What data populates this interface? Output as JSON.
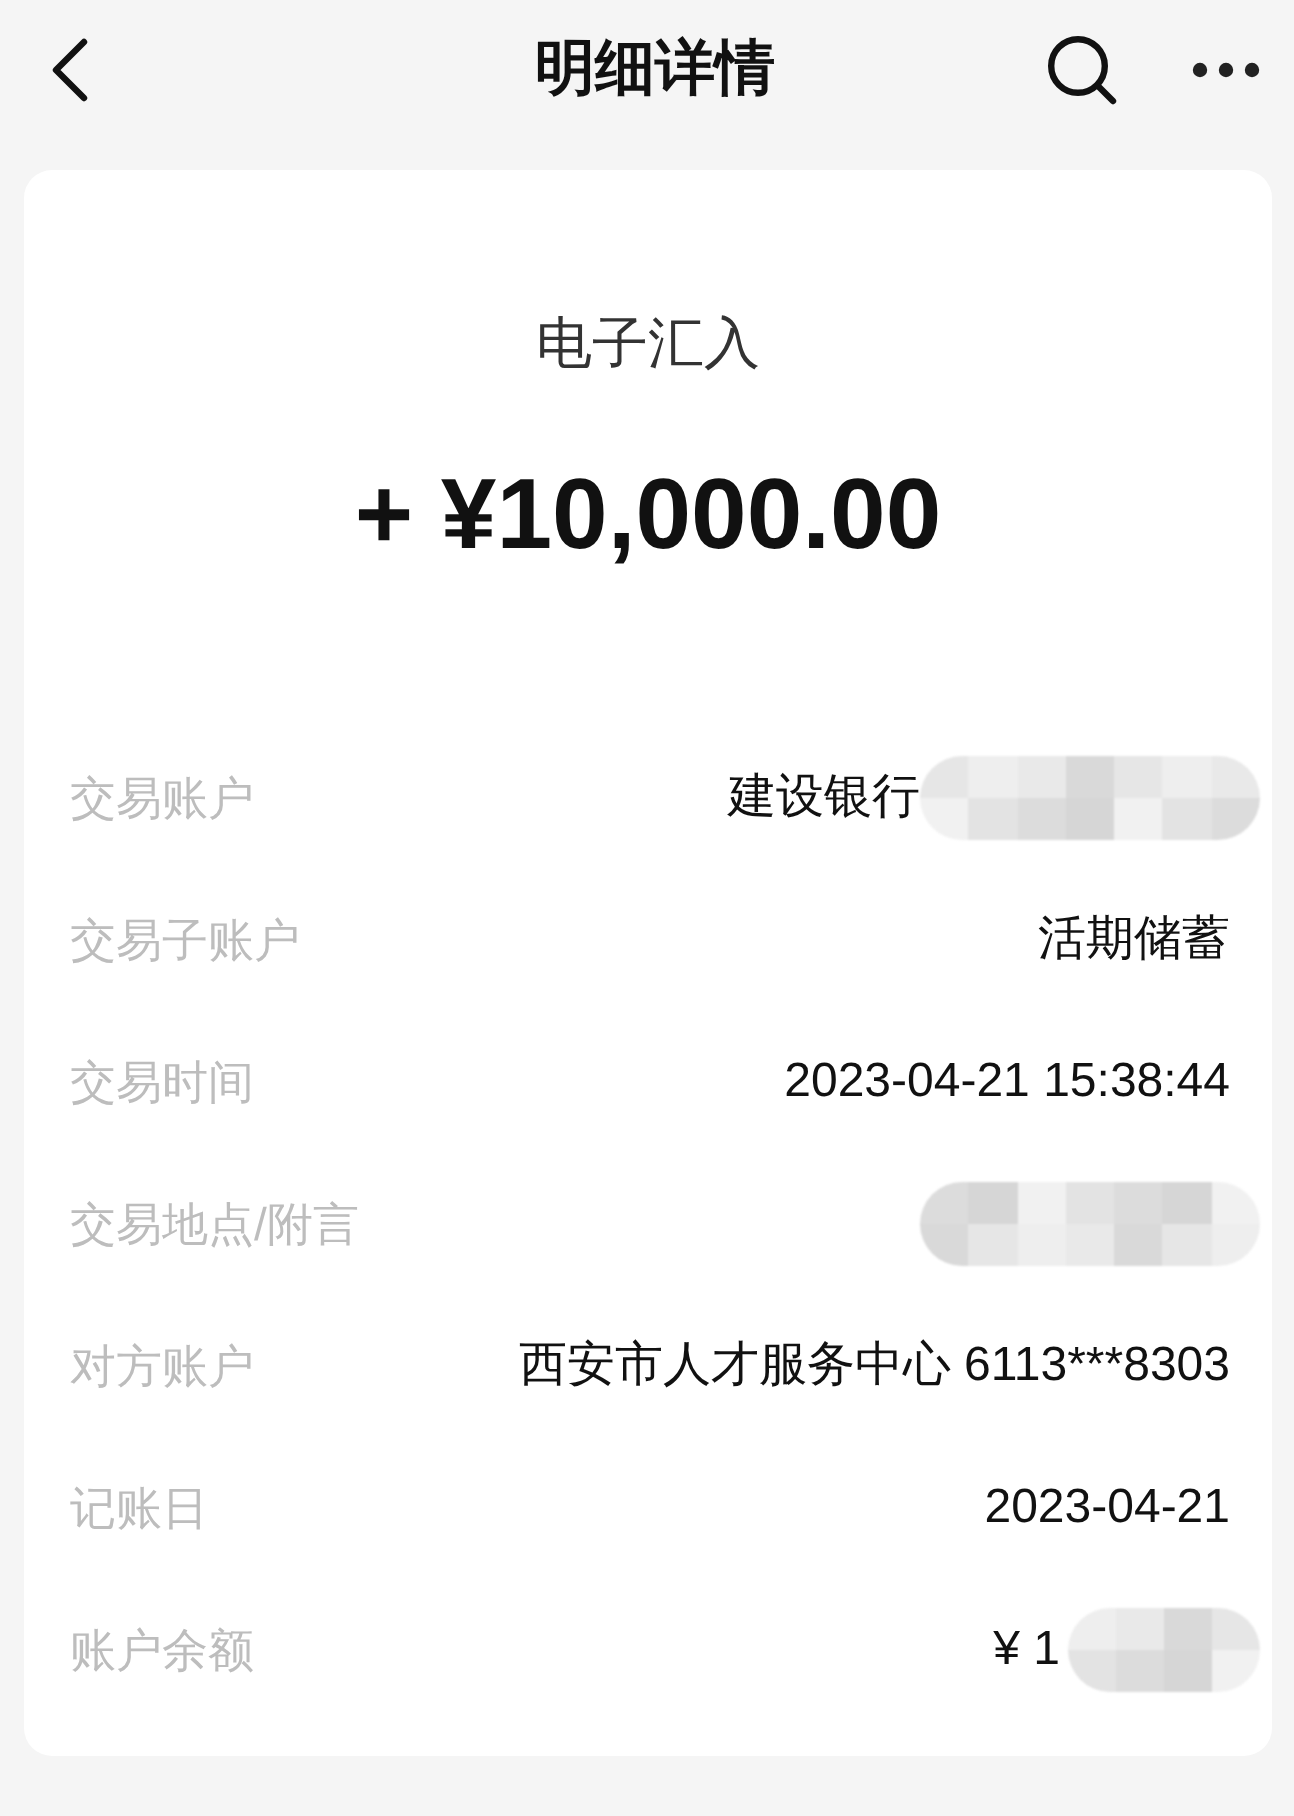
{
  "header": {
    "title": "明细详情"
  },
  "transaction": {
    "type": "电子汇入",
    "amount": "+ ¥10,000.00"
  },
  "rows": [
    {
      "label": "交易账户",
      "value": "建设银行",
      "redacted": true
    },
    {
      "label": "交易子账户",
      "value": "活期储蓄",
      "redacted": false
    },
    {
      "label": "交易时间",
      "value": "2023-04-21 15:38:44",
      "redacted": false
    },
    {
      "label": "交易地点/附言",
      "redacted": true
    },
    {
      "label": "对方账户",
      "value": "西安市人才服务中心 6113***8303",
      "redacted": false
    },
    {
      "label": "记账日",
      "value": "2023-04-21",
      "redacted": false
    },
    {
      "label": "账户余额",
      "value": "¥ 1",
      "redacted": true
    }
  ]
}
